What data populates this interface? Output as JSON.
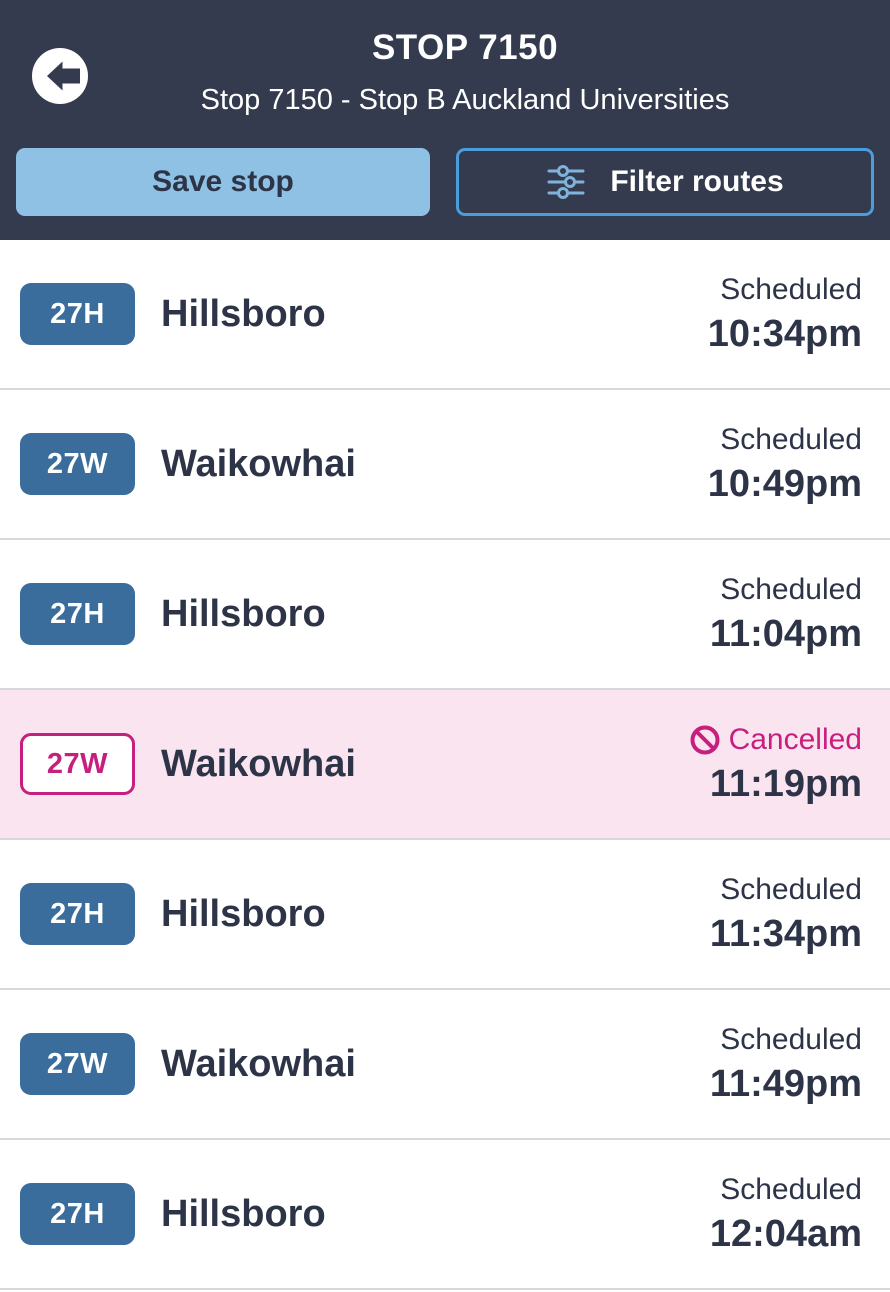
{
  "header": {
    "back_icon": "back-arrow-circle-icon",
    "title": "STOP 7150",
    "subtitle": "Stop 7150 - Stop B Auckland Universities",
    "background_color": "#343b4e",
    "save_button": {
      "label": "Save stop",
      "background_color": "#8ec1e4",
      "text_color": "#2d3447"
    },
    "filter_button": {
      "label": "Filter routes",
      "icon": "sliders-filter-icon",
      "border_color": "#4a9ede",
      "text_color": "#ffffff"
    }
  },
  "colors": {
    "route_badge": "#3b6d9c",
    "cancelled_accent": "#c71f7e",
    "cancelled_row_background": "#f9e4f0",
    "text_primary": "#2d3447",
    "divider": "#d8d8d8"
  },
  "departures": [
    {
      "route": "27H",
      "destination": "Hillsboro",
      "status": "Scheduled",
      "time": "10:34pm",
      "cancelled": false,
      "status_icon": ""
    },
    {
      "route": "27W",
      "destination": "Waikowhai",
      "status": "Scheduled",
      "time": "10:49pm",
      "cancelled": false,
      "status_icon": ""
    },
    {
      "route": "27H",
      "destination": "Hillsboro",
      "status": "Scheduled",
      "time": "11:04pm",
      "cancelled": false,
      "status_icon": ""
    },
    {
      "route": "27W",
      "destination": "Waikowhai",
      "status": "Cancelled",
      "time": "11:19pm",
      "cancelled": true,
      "status_icon": "prohibition-icon"
    },
    {
      "route": "27H",
      "destination": "Hillsboro",
      "status": "Scheduled",
      "time": "11:34pm",
      "cancelled": false,
      "status_icon": ""
    },
    {
      "route": "27W",
      "destination": "Waikowhai",
      "status": "Scheduled",
      "time": "11:49pm",
      "cancelled": false,
      "status_icon": ""
    },
    {
      "route": "27H",
      "destination": "Hillsboro",
      "status": "Scheduled",
      "time": "12:04am",
      "cancelled": false,
      "status_icon": ""
    }
  ]
}
